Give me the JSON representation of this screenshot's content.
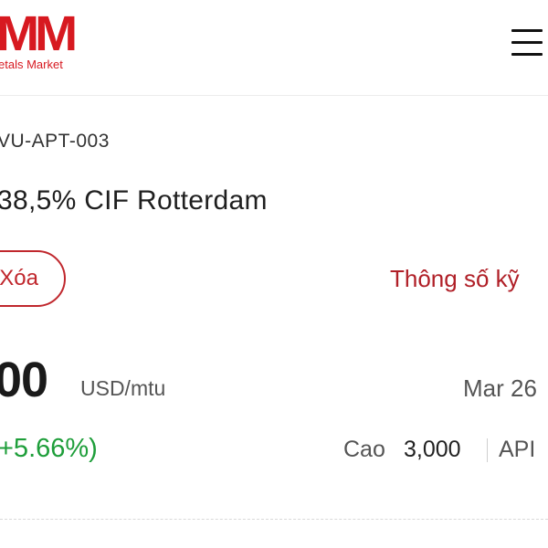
{
  "header": {
    "logo_mark": "MM",
    "logo_subtitle": "etals Market",
    "brand_color": "#d71920",
    "menu_icon": "hamburger-menu-icon"
  },
  "product": {
    "code": "VU-APT-003",
    "title": "38,5% CIF Rotterdam"
  },
  "actions": {
    "delete_label": "Xóa",
    "spec_label": "Thông số kỹ",
    "accent_color": "#c0272d"
  },
  "price": {
    "value": "00",
    "unit": "USD/mtu",
    "date": "Mar 26",
    "change": "+5.66%)",
    "change_color": "#1e9e3a",
    "high_label": "Cao",
    "high_value": "3,000",
    "api_label": "API"
  }
}
